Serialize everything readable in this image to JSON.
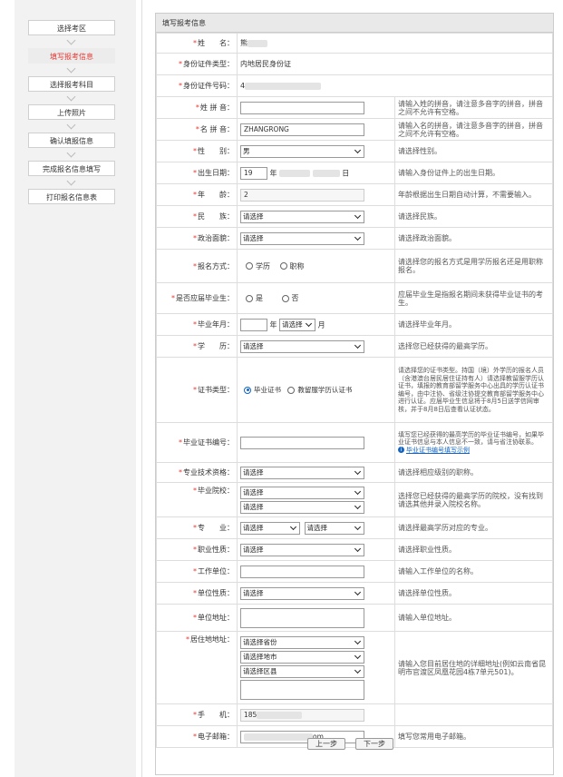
{
  "steps": [
    {
      "label": "选择考区",
      "active": false
    },
    {
      "label": "填写报考信息",
      "active": true
    },
    {
      "label": "选择报考科目",
      "active": false
    },
    {
      "label": "上传照片",
      "active": false
    },
    {
      "label": "确认填报信息",
      "active": false
    },
    {
      "label": "完成报名信息填写",
      "active": false
    },
    {
      "label": "打印报名信息表",
      "active": false
    }
  ],
  "panel": {
    "title": "填写报考信息"
  },
  "fields": {
    "name": {
      "label": "姓　　名：",
      "value": "熊"
    },
    "id_type": {
      "label": "身份证件类型：",
      "value": "内地居民身份证"
    },
    "id_no": {
      "label": "身份证件号码：",
      "value": "4"
    },
    "surname_pinyin": {
      "label": "姓 拼 音：",
      "value": "",
      "tip": "请输入姓的拼音，请注意多音字的拼音，拼音之间不允许有空格。"
    },
    "name_pinyin": {
      "label": "名 拼 音：",
      "value": "ZHANGRONG",
      "tip": "请输入名的拼音，请注意多音字的拼音，拼音之间不允许有空格。"
    },
    "gender": {
      "label": "性　　别：",
      "value": "男",
      "tip": "请选择性别。"
    },
    "birth": {
      "label": "出生日期：",
      "year": "19",
      "year_unit": "年",
      "day_unit": "日",
      "tip": "请输入身份证件上的出生日期。"
    },
    "age": {
      "label": "年　　龄：",
      "value": "2",
      "tip": "年龄根据出生日期自动计算，不需要输入。"
    },
    "ethnic": {
      "label": "民　　族：",
      "value": "请选择",
      "tip": "请选择民族。"
    },
    "political": {
      "label": "政治面貌：",
      "value": "请选择",
      "tip": "请选择政治面貌。"
    },
    "apply_mode": {
      "label": "报名方式：",
      "opt1": "学历",
      "opt2": "职称",
      "tip": "请选择您的报名方式是用学历报名还是用职称报名。"
    },
    "fresh_grad": {
      "label": "是否应届毕业生：",
      "opt1": "是",
      "opt2": "否",
      "tip": "应届毕业生是指报名期间未获得毕业证书的考生。"
    },
    "grad_date": {
      "label": "毕业年月：",
      "year_unit": "年",
      "month_value": "请选择",
      "month_unit": "月",
      "tip": "请选择毕业年月。"
    },
    "education": {
      "label": "学　　历：",
      "value": "请选择",
      "tip": "选择您已经获得的最高学历。"
    },
    "cert_type": {
      "label": "证书类型：",
      "opt1": "毕业证书",
      "opt2": "教留服学历认证书",
      "tip": "请选择您的证书类型。持国（境）外学历的报名人员（含港澳台居民居住证持有人）请选择教留服学历认证书，填报的教育部留学服务中心出具的学历认证书编号，由中注协、省级注协提交教育部留学服务中心进行认证。应届毕业生信息将于8月5日送学信网审核，并于8月8日后查看认证状态。"
    },
    "cert_no": {
      "label": "毕业证书编号：",
      "tip": "填写您已经获得的最高学历的毕业证书编号，如果毕业证书信息与本人信息不一致，请与省注协联系。",
      "link": "毕业证书编号填写示例"
    },
    "prof_title": {
      "label": "专业技术资格：",
      "value": "请选择",
      "tip": "请选择相应级别的职称。"
    },
    "school": {
      "label": "毕业院校：",
      "value1": "请选择",
      "value2": "请选择",
      "tip": "选择您已经获得的最高学历的院校，没有找到请选其他并录入院校名称。"
    },
    "major": {
      "label": "专　　业：",
      "value1": "请选择",
      "value2": "请选择",
      "tip": "请选择最高学历对应的专业。"
    },
    "job_nature": {
      "label": "职业性质：",
      "value": "请选择",
      "tip": "请选择职业性质。"
    },
    "employer": {
      "label": "工作单位：",
      "tip": "请输入工作单位的名称。"
    },
    "unit_nature": {
      "label": "单位性质：",
      "value": "请选择",
      "tip": "请选择单位性质。"
    },
    "unit_addr": {
      "label": "单位地址：",
      "tip": "请输入单位地址。"
    },
    "residence": {
      "label": "居住地地址：",
      "province": "请选择省份",
      "city": "请选择地市",
      "district": "请选择区县",
      "tip": "请输入您目前居住地的详细地址(例如云南省昆明市官渡区凤凰花园4栋7单元501)。"
    },
    "mobile": {
      "label": "手　　机：",
      "value": "185"
    },
    "email": {
      "label": "电子邮箱：",
      "value": "om",
      "tip": "填写您常用电子邮箱。"
    }
  },
  "buttons": {
    "prev": "上一步",
    "next": "下一步"
  },
  "colors": {
    "accent_red": "#e43a36",
    "required_star": "#e53935",
    "radio_blue": "#1565c0"
  }
}
